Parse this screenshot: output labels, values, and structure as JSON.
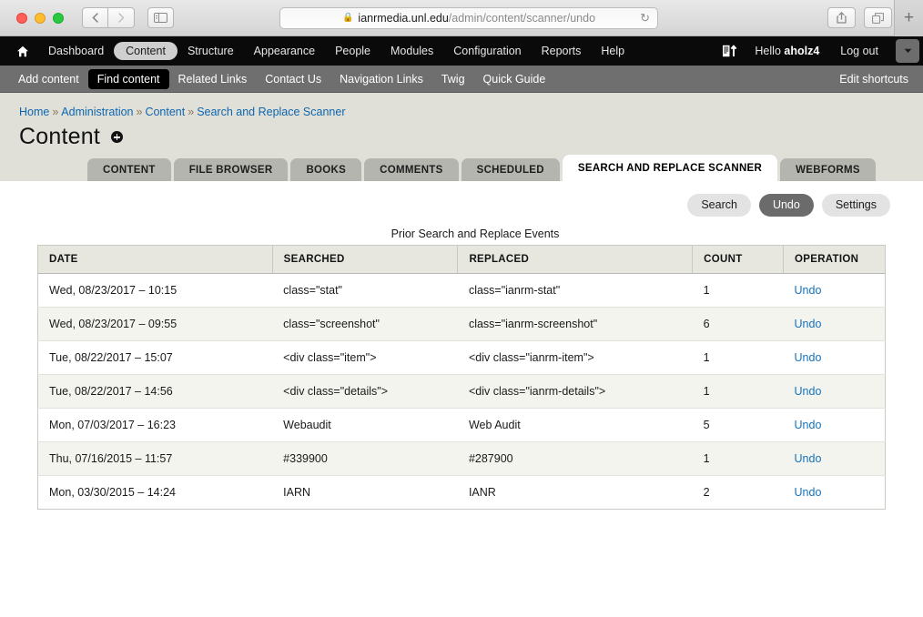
{
  "browser": {
    "url_host": "ianrmedia.unl.edu",
    "url_path": "/admin/content/scanner/undo",
    "lock_icon": "lock-icon",
    "reload_icon": "reload-icon",
    "back_icon": "back-chevron-icon",
    "forward_icon": "forward-chevron-icon",
    "sidebar_icon": "sidebar-toggle-icon",
    "share_icon": "share-icon",
    "tabs_icon": "show-tabs-icon",
    "new_tab_label": "+"
  },
  "admin_toolbar": {
    "home_icon": "home-icon",
    "items": [
      {
        "label": "Dashboard",
        "active": false
      },
      {
        "label": "Content",
        "active": true
      },
      {
        "label": "Structure",
        "active": false
      },
      {
        "label": "Appearance",
        "active": false
      },
      {
        "label": "People",
        "active": false
      },
      {
        "label": "Modules",
        "active": false
      },
      {
        "label": "Configuration",
        "active": false
      },
      {
        "label": "Reports",
        "active": false
      },
      {
        "label": "Help",
        "active": false
      }
    ],
    "compose_icon": "compose-upload-icon",
    "greeting_prefix": "Hello ",
    "username": "aholz4",
    "logout_label": "Log out",
    "caret_icon": "chevron-down-icon"
  },
  "shortcut_bar": {
    "items": [
      {
        "label": "Add content",
        "active": false
      },
      {
        "label": "Find content",
        "active": true
      },
      {
        "label": "Related Links",
        "active": false
      },
      {
        "label": "Contact Us",
        "active": false
      },
      {
        "label": "Navigation Links",
        "active": false
      },
      {
        "label": "Twig",
        "active": false
      },
      {
        "label": "Quick Guide",
        "active": false
      }
    ],
    "edit_label": "Edit shortcuts"
  },
  "breadcrumb": {
    "separator": "»",
    "items": [
      "Home",
      "Administration",
      "Content",
      "Search and Replace Scanner"
    ]
  },
  "page": {
    "title": "Content",
    "add_icon": "plus-circle-icon"
  },
  "tabs": [
    {
      "label": "CONTENT",
      "active": false
    },
    {
      "label": "FILE BROWSER",
      "active": false
    },
    {
      "label": "BOOKS",
      "active": false
    },
    {
      "label": "COMMENTS",
      "active": false
    },
    {
      "label": "SCHEDULED",
      "active": false
    },
    {
      "label": "SEARCH AND REPLACE SCANNER",
      "active": true
    },
    {
      "label": "WEBFORMS",
      "active": false
    }
  ],
  "subtabs": [
    {
      "label": "Search",
      "active": false
    },
    {
      "label": "Undo",
      "active": true
    },
    {
      "label": "Settings",
      "active": false
    }
  ],
  "table": {
    "caption": "Prior Search and Replace Events",
    "headers": [
      "DATE",
      "SEARCHED",
      "REPLACED",
      "COUNT",
      "OPERATION"
    ],
    "rows": [
      {
        "date": "Wed, 08/23/2017 – 10:15",
        "searched": "class=\"stat\"",
        "replaced": "class=\"ianrm-stat\"",
        "count": "1",
        "operation": "Undo"
      },
      {
        "date": "Wed, 08/23/2017 – 09:55",
        "searched": "class=\"screenshot\"",
        "replaced": "class=\"ianrm-screenshot\"",
        "count": "6",
        "operation": "Undo"
      },
      {
        "date": "Tue, 08/22/2017 – 15:07",
        "searched": "<div class=\"item\">",
        "replaced": "<div class=\"ianrm-item\">",
        "count": "1",
        "operation": "Undo"
      },
      {
        "date": "Tue, 08/22/2017 – 14:56",
        "searched": "<div class=\"details\">",
        "replaced": "<div class=\"ianrm-details\">",
        "count": "1",
        "operation": "Undo"
      },
      {
        "date": "Mon, 07/03/2017 – 16:23",
        "searched": "Webaudit",
        "replaced": "Web Audit",
        "count": "5",
        "operation": "Undo"
      },
      {
        "date": "Thu, 07/16/2015 – 11:57",
        "searched": "#339900",
        "replaced": "#287900",
        "count": "1",
        "operation": "Undo"
      },
      {
        "date": "Mon, 03/30/2015 – 14:24",
        "searched": "IARN",
        "replaced": "IANR",
        "count": "2",
        "operation": "Undo"
      }
    ]
  },
  "colors": {
    "link": "#1572bd",
    "breadcrumb_link": "#0d66b0",
    "toolbar_bg": "#0a0a0a",
    "shortcut_bg": "#6f6f6f",
    "header_bg": "#e0e0d8",
    "tab_inactive_bg": "#b5b5b0",
    "subtab_active_bg": "#6b6b6b",
    "row_stripe": "#f4f4ef"
  }
}
